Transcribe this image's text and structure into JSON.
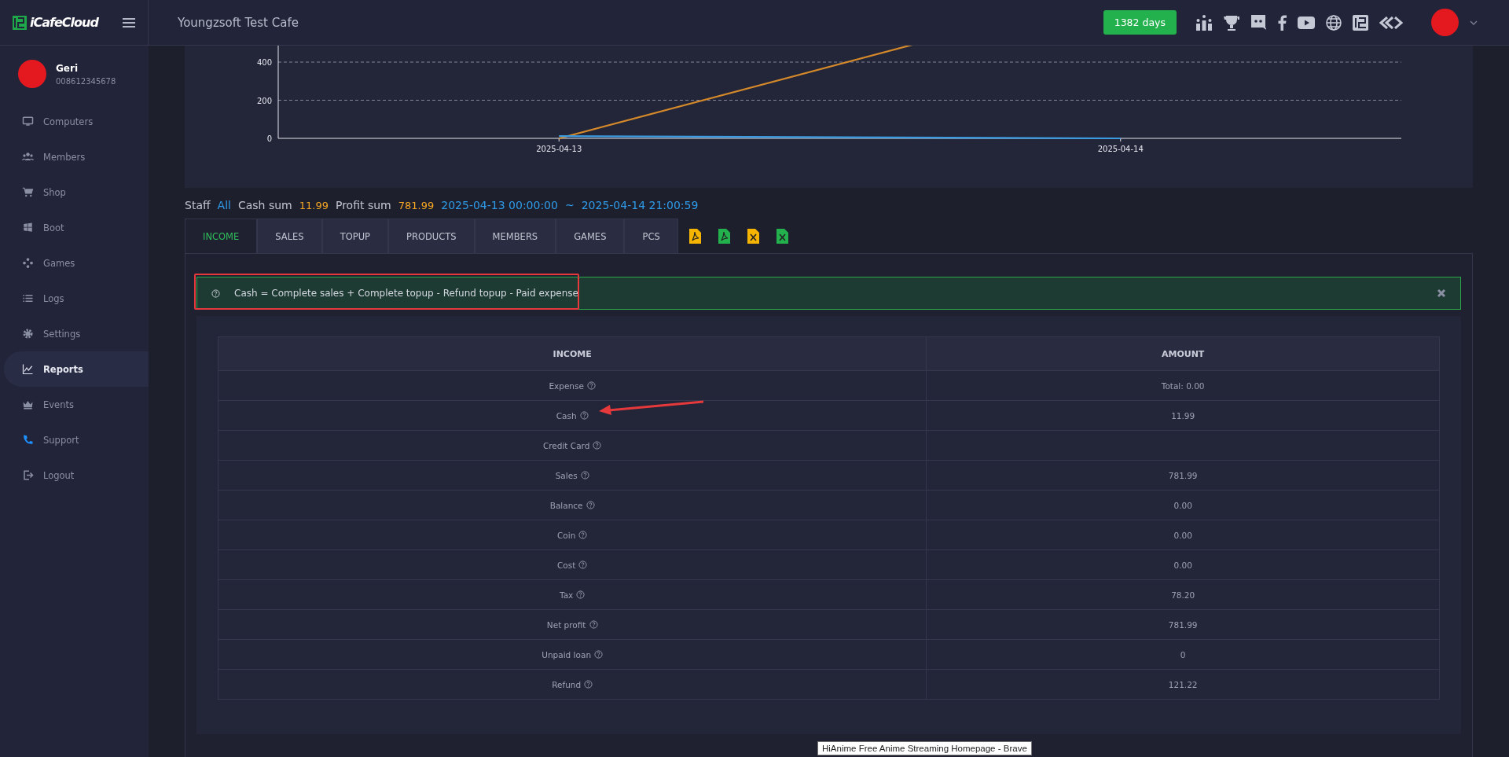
{
  "topbar": {
    "brand": "iCafeCloud",
    "cafe_name": "Youngzsoft Test Cafe",
    "days_badge": "1382 days"
  },
  "user": {
    "name": "Geri",
    "phone": "008612345678"
  },
  "sidebar": {
    "items": [
      {
        "label": "Computers",
        "selected": false
      },
      {
        "label": "Members",
        "selected": false
      },
      {
        "label": "Shop",
        "selected": false
      },
      {
        "label": "Boot",
        "selected": false
      },
      {
        "label": "Games",
        "selected": false
      },
      {
        "label": "Logs",
        "selected": false
      },
      {
        "label": "Settings",
        "selected": false
      },
      {
        "label": "Reports",
        "selected": true
      },
      {
        "label": "Events",
        "selected": false
      },
      {
        "label": "Support",
        "selected": false
      },
      {
        "label": "Logout",
        "selected": false
      }
    ]
  },
  "chart": {
    "chart_data": {
      "type": "line",
      "categories": [
        "2025-04-13",
        "2025-04-14"
      ],
      "ylim": [
        0,
        800
      ],
      "yticks": [
        0,
        200,
        400
      ],
      "series": [
        {
          "color": "#d4892a",
          "values": [
            0,
            780
          ]
        },
        {
          "color": "#3b9be0",
          "values": [
            12,
            0
          ]
        }
      ]
    }
  },
  "filter": {
    "staff_label": "Staff",
    "staff_value": "All",
    "cash_label": "Cash sum",
    "cash_value": "11.99",
    "profit_label": "Profit sum",
    "profit_value": "781.99",
    "range_start": "2025-04-13 00:00:00",
    "range_sep": "~",
    "range_end": "2025-04-14 21:00:59"
  },
  "tabs": [
    {
      "label": "INCOME",
      "selected": true
    },
    {
      "label": "SALES",
      "selected": false
    },
    {
      "label": "TOPUP",
      "selected": false
    },
    {
      "label": "PRODUCTS",
      "selected": false
    },
    {
      "label": "MEMBERS",
      "selected": false
    },
    {
      "label": "GAMES",
      "selected": false
    },
    {
      "label": "PCS",
      "selected": false
    }
  ],
  "alert": {
    "text": "Cash = Complete sales + Complete topup - Refund topup - Paid expense"
  },
  "table": {
    "columns": [
      "INCOME",
      "AMOUNT"
    ],
    "rows": [
      {
        "item": "Expense",
        "amount": "Total: 0.00"
      },
      {
        "item": "Cash",
        "amount": "11.99"
      },
      {
        "item": "Credit Card"
      },
      {
        "item": "Sales",
        "amount": "781.99"
      },
      {
        "item": "Balance",
        "amount": "0.00"
      },
      {
        "item": "Coin",
        "amount": "0.00"
      },
      {
        "item": "Cost",
        "amount": "0.00"
      },
      {
        "item": "Tax",
        "amount": "78.20"
      },
      {
        "item": "Net profit",
        "amount": "781.99"
      },
      {
        "item": "Unpaid loan",
        "amount": "0"
      },
      {
        "item": "Refund",
        "amount": "121.22"
      }
    ]
  },
  "tooltip": "HiAnime Free Anime Streaming Homepage - Brave"
}
